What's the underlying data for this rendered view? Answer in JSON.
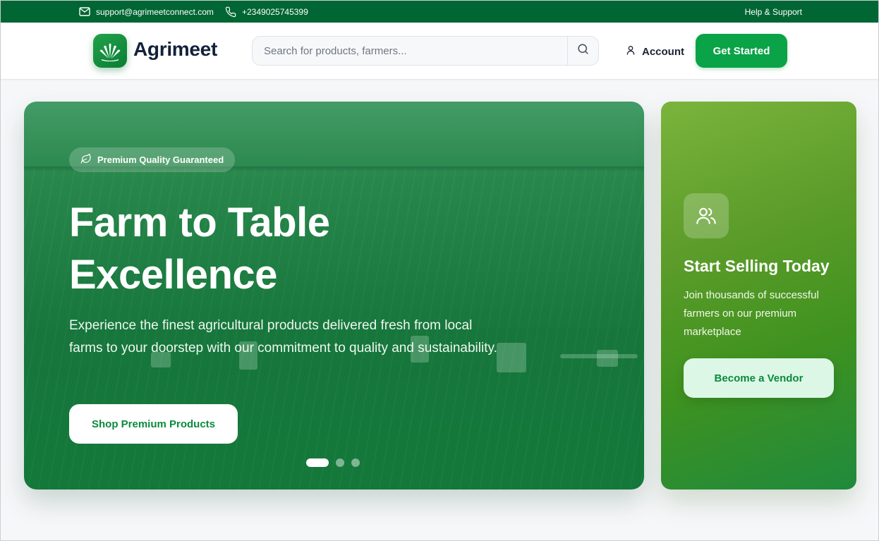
{
  "topbar": {
    "email": "support@agrimeetconnect.com",
    "phone": "+2349025745399",
    "help": "Help & Support",
    "icons": {
      "email": "mail-icon",
      "phone": "phone-icon"
    }
  },
  "header": {
    "brand": "Agrimeet",
    "search_placeholder": "Search for products, farmers...",
    "account_label": "Account",
    "cta_label": "Get Started"
  },
  "hero": {
    "badge": "Premium Quality Guaranteed",
    "title": "Farm to Table Excellence",
    "subtitle": "Experience the finest agricultural products delivered fresh from local farms to your doorstep with our commitment to quality and sustainability.",
    "button": "Shop Premium Products",
    "slides_total": 3,
    "active_slide": 1
  },
  "vendor": {
    "title": "Start Selling Today",
    "text": "Join thousands of successful farmers on our premium marketplace",
    "button": "Become a Vendor"
  },
  "colors": {
    "topbar": "#006633",
    "primary": "#0aa347",
    "brand_text": "#13213a",
    "vendor_gradient_start": "#7ab43c",
    "vendor_gradient_end": "#1f8a3d"
  }
}
